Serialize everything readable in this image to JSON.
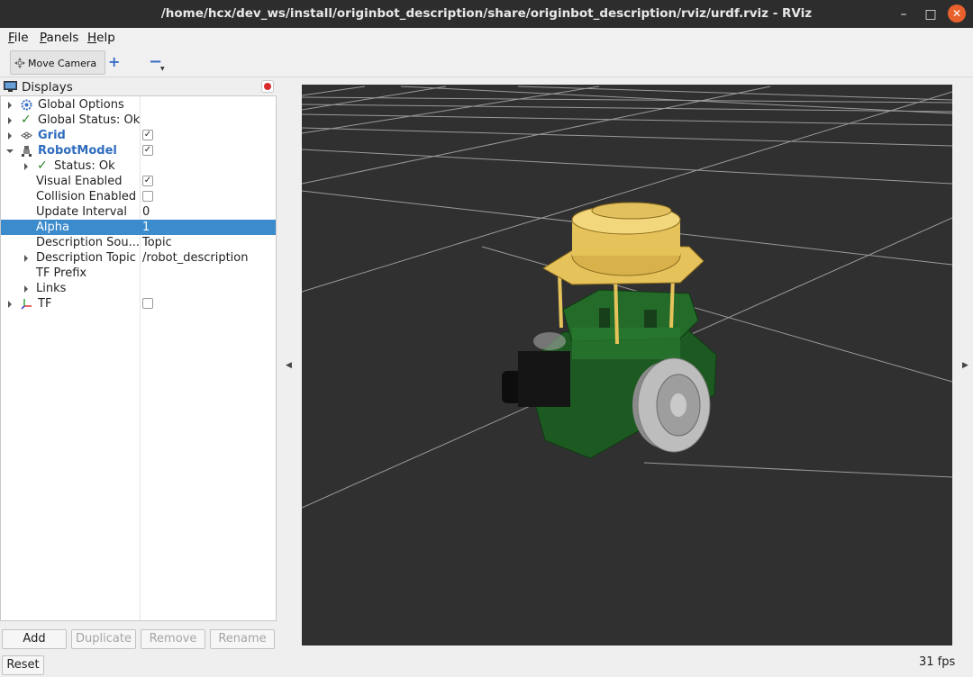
{
  "window": {
    "title": "/home/hcx/dev_ws/install/originbot_description/share/originbot_description/rviz/urdf.rviz - RViz",
    "min_glyph": "–",
    "max_glyph": "□",
    "close_glyph": "✕"
  },
  "menu": {
    "file": "File",
    "panels": "Panels",
    "help": "Help"
  },
  "toolbar": {
    "move_camera": "Move Camera",
    "add_tool": "+",
    "remove_tool": "−"
  },
  "displays": {
    "title": "Displays",
    "rows": [
      {
        "label": "Global Options",
        "value": ""
      },
      {
        "label": "Global Status: Ok",
        "value": ""
      },
      {
        "label": "Grid",
        "value": ""
      },
      {
        "label": "RobotModel",
        "value": ""
      },
      {
        "label": "Status: Ok",
        "value": ""
      },
      {
        "label": "Visual Enabled",
        "value": ""
      },
      {
        "label": "Collision Enabled",
        "value": ""
      },
      {
        "label": "Update Interval",
        "value": "0"
      },
      {
        "label": "Alpha",
        "value": "1"
      },
      {
        "label": "Description Sou...",
        "value": "Topic"
      },
      {
        "label": "Description Topic",
        "value": "/robot_description"
      },
      {
        "label": "TF Prefix",
        "value": ""
      },
      {
        "label": "Links",
        "value": ""
      },
      {
        "label": "TF",
        "value": ""
      }
    ],
    "checkboxes": {
      "grid": true,
      "robot_model": true,
      "visual_enabled": true,
      "collision_enabled": false,
      "tf": false
    }
  },
  "buttons": {
    "add": "Add",
    "duplicate": "Duplicate",
    "remove": "Remove",
    "rename": "Rename",
    "reset": "Reset"
  },
  "status": {
    "fps": "31 fps"
  },
  "colors": {
    "selection": "#3c8bcd",
    "viewport_bg": "#303030",
    "grid_line": "#a0a0a0",
    "robot_green": "#1f5a1f",
    "lidar_gold": "#e6c35a",
    "wheel_grey": "#bdbdbd",
    "close_orange": "#e8602c"
  }
}
